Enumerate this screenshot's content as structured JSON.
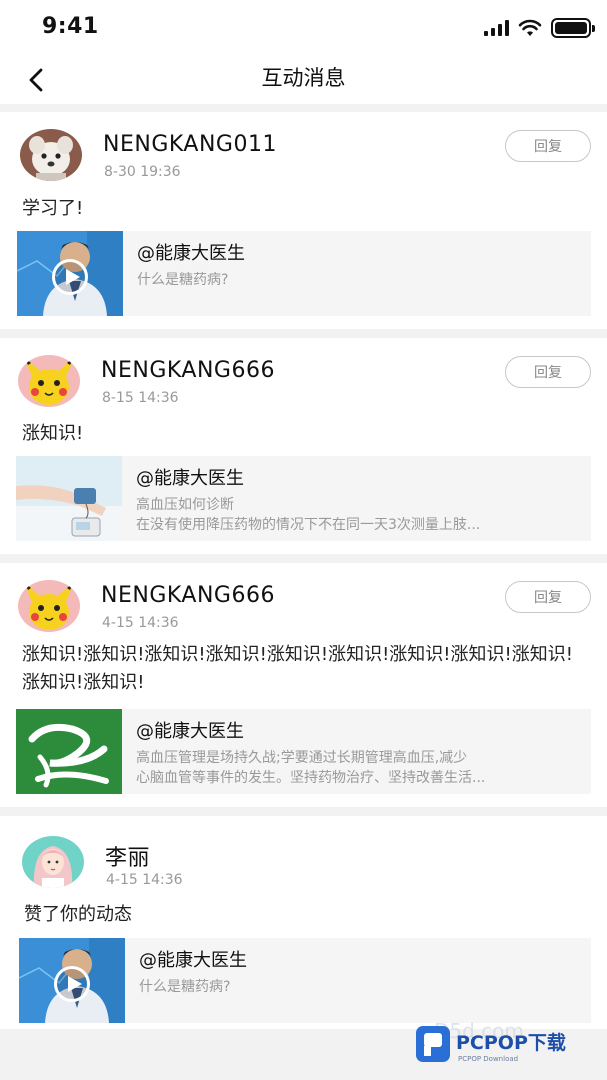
{
  "status": {
    "time": "9:41"
  },
  "nav": {
    "title": "互动消息"
  },
  "reply_label": "回复",
  "items": [
    {
      "user": "NENGKANG011",
      "time": "8-30 19:36",
      "comment": "学习了!",
      "avatar": "dog-avatar",
      "ref": {
        "author": "@能康大医生",
        "text1": "什么是糖药病?",
        "text2": "",
        "thumb": "video-doctor"
      }
    },
    {
      "user": "NENGKANG666",
      "time": "8-15 14:36",
      "comment": "涨知识!",
      "avatar": "pikachu-avatar",
      "ref": {
        "author": "@能康大医生",
        "text1": "高血压如何诊断",
        "text2": "在没有使用降压药物的情况下不在同一天3次测量上肢...",
        "thumb": "blood-pressure-photo"
      }
    },
    {
      "user": "NENGKANG666",
      "time": "4-15 14:36",
      "comment": "涨知识!涨知识!涨知识!涨知识!涨知识!涨知识!涨知识!涨知识!涨知识!涨知识!涨知识!",
      "avatar": "pikachu-avatar",
      "ref": {
        "author": "@能康大医生",
        "text1": "高血压管理是场持久战;学要通过长期管理高血压,减少",
        "text2": "心脑血管等事件的发生。坚持药物治疗、坚持改善生活...",
        "thumb": "green-logo"
      }
    },
    {
      "user": "李丽",
      "time": "4-15 14:36",
      "comment": "赞了你的动态",
      "avatar": "girl-avatar",
      "ref": {
        "author": "@能康大医生",
        "text1": "什么是糖药病?",
        "text2": "",
        "thumb": "video-doctor"
      }
    }
  ],
  "watermark": {
    "brand": "PCPOP下载",
    "sub": "PCPOP Download",
    "bg_text": "D5d.com"
  },
  "colors": {
    "accent": "#2d8c3c",
    "card": "#ffffff",
    "page": "#f2f2f2"
  }
}
